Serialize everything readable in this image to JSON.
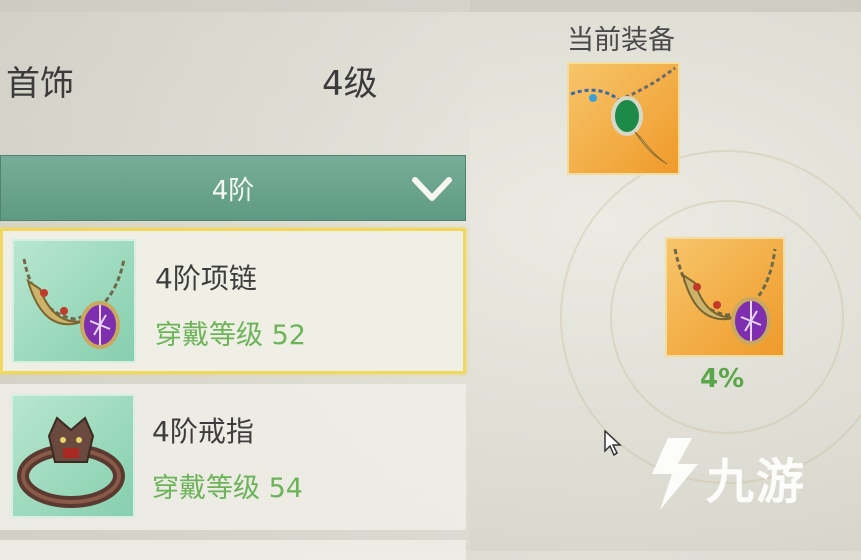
{
  "header": {
    "category": "首饰",
    "level": "4级"
  },
  "tier_dropdown": {
    "selected": "4阶"
  },
  "items": [
    {
      "name": "4阶项链",
      "requirement": "穿戴等级 52",
      "icon": "necklace-purple-gem-icon",
      "selected": true
    },
    {
      "name": "4阶戒指",
      "requirement": "穿戴等级 54",
      "icon": "ring-beast-icon",
      "selected": false
    }
  ],
  "current_equipment": {
    "label": "当前装备",
    "icon": "necklace-green-jade-icon"
  },
  "drop_preview": {
    "icon": "necklace-purple-gem-icon",
    "chance": "4%"
  },
  "watermark": {
    "text": "九游"
  },
  "colors": {
    "dropdown_bg": "#6aa48e",
    "requirement_green": "#6cb35a",
    "selected_border": "#f0d860",
    "orange_tile": "#ef9a2a",
    "green_tile": "#86cfae"
  }
}
